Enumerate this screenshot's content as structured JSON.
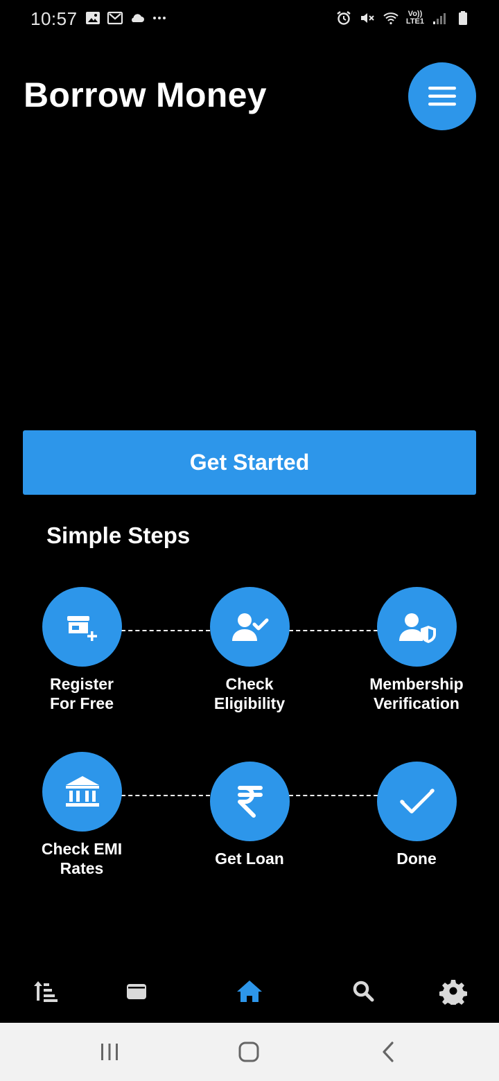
{
  "status_bar": {
    "time": "10:57",
    "left_icons": [
      "image-icon",
      "gmail-icon",
      "cloud-icon",
      "more-dots-icon"
    ],
    "right_icons": [
      "alarm-icon",
      "mute-icon",
      "wifi-icon",
      "volte-lte-icon",
      "signal-icon",
      "battery-icon"
    ],
    "network_top": "Vo))",
    "network_bottom": "LTE1"
  },
  "header": {
    "title": "Borrow Money",
    "menu_icon": "hamburger-menu-icon"
  },
  "primary_action": {
    "label": "Get Started"
  },
  "steps_section": {
    "title": "Simple Steps",
    "steps": [
      {
        "label": "Register\nFor Free",
        "icon": "store-add-icon"
      },
      {
        "label": "Check\nEligibility",
        "icon": "user-check-icon"
      },
      {
        "label": "Membership\nVerification",
        "icon": "user-shield-icon"
      },
      {
        "label": "Check EMI\nRates",
        "icon": "bank-icon"
      },
      {
        "label": "Get Loan",
        "icon": "rupee-icon"
      },
      {
        "label": "Done",
        "icon": "check-icon"
      }
    ]
  },
  "bottom_nav": {
    "items": [
      {
        "name": "sort",
        "icon": "sort-list-icon",
        "active": false
      },
      {
        "name": "wallet",
        "icon": "wallet-icon",
        "active": false
      },
      {
        "name": "home",
        "icon": "home-icon",
        "active": true
      },
      {
        "name": "search",
        "icon": "search-icon",
        "active": false
      },
      {
        "name": "settings",
        "icon": "gear-icon",
        "active": false
      }
    ],
    "active_color": "#2d96ea",
    "inactive_color": "#d9d9d9"
  },
  "system_nav": {
    "buttons": [
      "recents-icon",
      "home-outline-icon",
      "back-icon"
    ]
  },
  "colors": {
    "accent": "#2d96ea",
    "background": "#000000",
    "text": "#ffffff"
  }
}
